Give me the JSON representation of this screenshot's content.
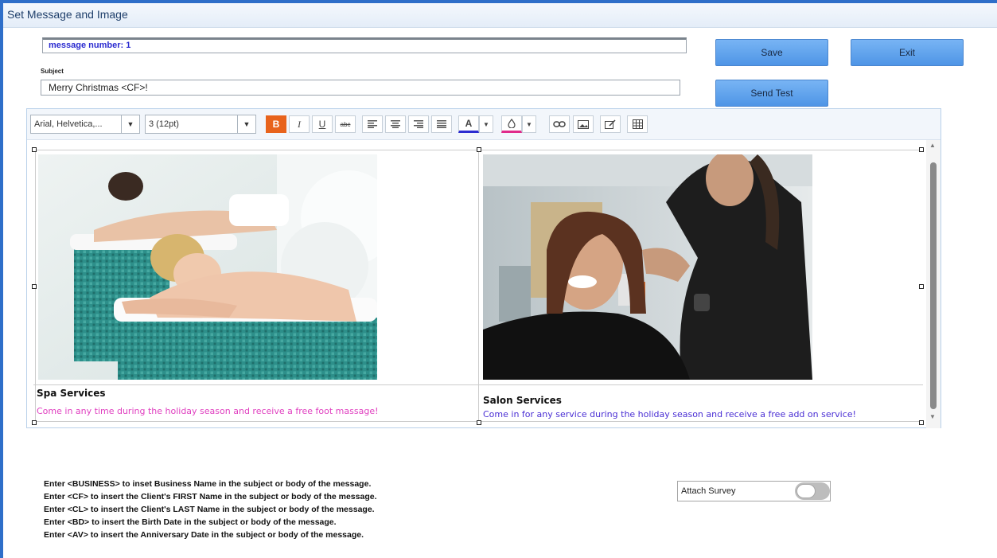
{
  "window": {
    "title": "Set Message and Image"
  },
  "form": {
    "message_number": "message number: 1",
    "subject_label": "Subject",
    "subject_value": "Merry Christmas <CF>!"
  },
  "buttons": {
    "save": "Save",
    "exit": "Exit",
    "send_test": "Send Test"
  },
  "toolbar": {
    "font_family": "Arial, Helvetica,...",
    "font_size": "3 (12pt)",
    "bold": "B",
    "italic": "I",
    "underline": "U",
    "strike": "abc",
    "font_color_letter": "A",
    "dropdown_glyph": "▼",
    "icons": [
      "bold-icon",
      "italic-icon",
      "underline-icon",
      "strikethrough-icon",
      "align-left-icon",
      "align-center-icon",
      "align-right-icon",
      "justify-icon",
      "font-color-icon",
      "background-color-icon",
      "link-icon",
      "image-icon",
      "edit-html-icon",
      "table-icon"
    ]
  },
  "content": {
    "left": {
      "title": "Spa Services",
      "text": "Come in any time during the holiday season and receive a free foot massage!",
      "color": "#e040c0"
    },
    "right": {
      "title": "Salon Services",
      "text": "Come in for any service during the holiday season and receive a free add on service!",
      "color": "#4a2fd4"
    }
  },
  "notes": [
    "Enter <BUSINESS> to inset Business Name in the subject or body of the message.",
    "Enter <CF> to insert the Client's FIRST Name in the subject or body of the message.",
    "Enter <CL> to insert the Client's LAST Name in the subject or body of the message.",
    "Enter <BD> to insert the Birth Date in the subject or body of the message.",
    "Enter <AV> to insert the Anniversary Date in the subject or body of the message."
  ],
  "survey": {
    "label": "Attach Survey",
    "enabled": false
  },
  "colors": {
    "accent_button": "#5b9fe9",
    "bold_active": "#e8631c",
    "window_border": "#2f6fc9"
  }
}
